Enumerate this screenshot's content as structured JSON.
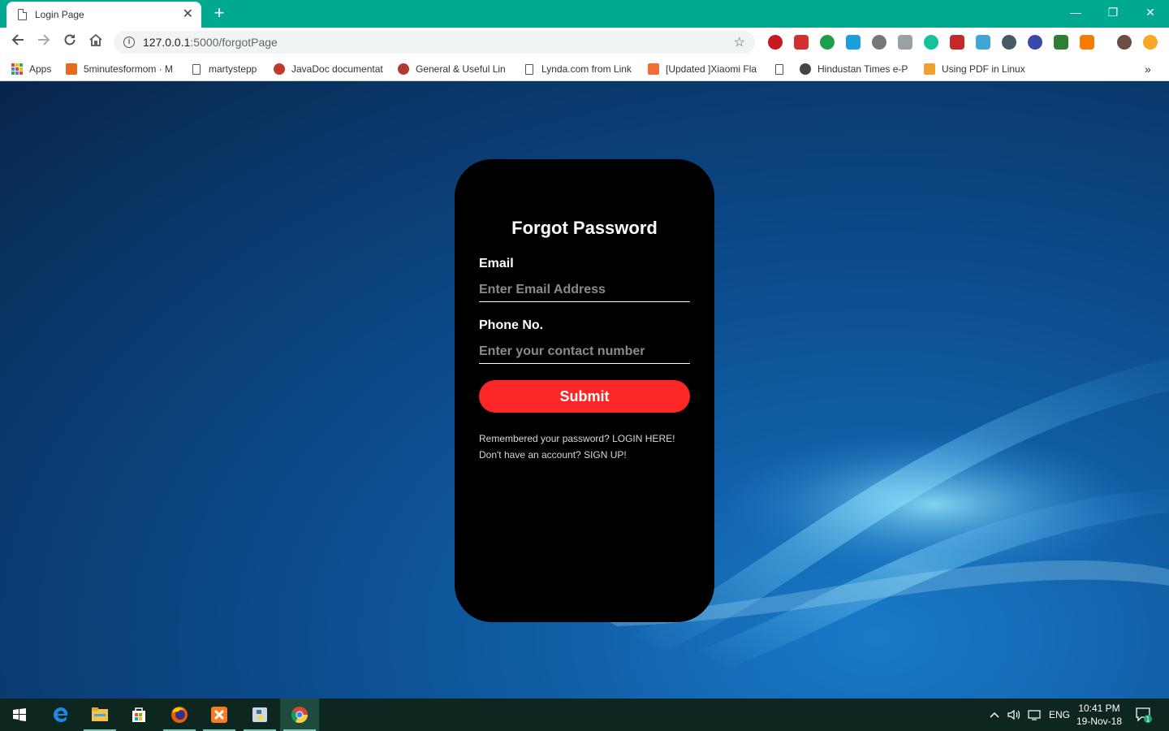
{
  "browser": {
    "tab_title": "Login Page",
    "tab_close": "✕",
    "new_tab": "+",
    "window_controls": {
      "minimize": "—",
      "maximize": "❐",
      "close": "✕"
    },
    "url_host": "127.0.0.1",
    "url_path": ":5000/forgotPage"
  },
  "bookmarks": [
    {
      "label": "Apps",
      "icon": "apps-grid-icon"
    },
    {
      "label": "5minutesformom · M",
      "icon": "5minutesformom-favicon",
      "color": "#e86a1f"
    },
    {
      "label": "martystepp",
      "icon": "page-icon"
    },
    {
      "label": "JavaDoc documentat",
      "icon": "javadoc-favicon",
      "color": "#c0392b"
    },
    {
      "label": "General & Useful Lin",
      "icon": "general-favicon",
      "color": "#b03a2e"
    },
    {
      "label": "Lynda.com from Link",
      "icon": "page-icon"
    },
    {
      "label": "[Updated ]Xiaomi Fla",
      "icon": "miui-favicon",
      "color": "#f26b38"
    },
    {
      "label": "",
      "icon": "page-icon"
    },
    {
      "label": "Hindustan Times e-P",
      "icon": "hindustan-times-favicon",
      "color": "#444444"
    },
    {
      "label": "Using PDF in Linux",
      "icon": "pdf-favicon",
      "color": "#f0a030"
    }
  ],
  "bookmarks_overflow": "»",
  "form": {
    "title": "Forgot Password",
    "email_label": "Email",
    "email_placeholder": "Enter Email Address",
    "email_value": "",
    "phone_label": "Phone No.",
    "phone_placeholder": "Enter your contact number",
    "phone_value": "",
    "submit_label": "Submit",
    "login_prompt": "Remembered your password?",
    "login_link": "LOGIN HERE!",
    "signup_prompt": "Don't have an account?",
    "signup_link": "SIGN UP!"
  },
  "taskbar": {
    "apps": [
      "start-icon",
      "edge-icon",
      "file-explorer-icon",
      "store-icon",
      "firefox-icon",
      "xampp-icon",
      "python-icon",
      "chrome-icon"
    ],
    "language": "ENG",
    "time": "10:41 PM",
    "date": "19-Nov-18",
    "notification_count": "1"
  },
  "colors": {
    "tab_strip": "#00a98f",
    "card_background": "#000000",
    "submit_button": "#fb2626",
    "taskbar": "#0d2620"
  }
}
